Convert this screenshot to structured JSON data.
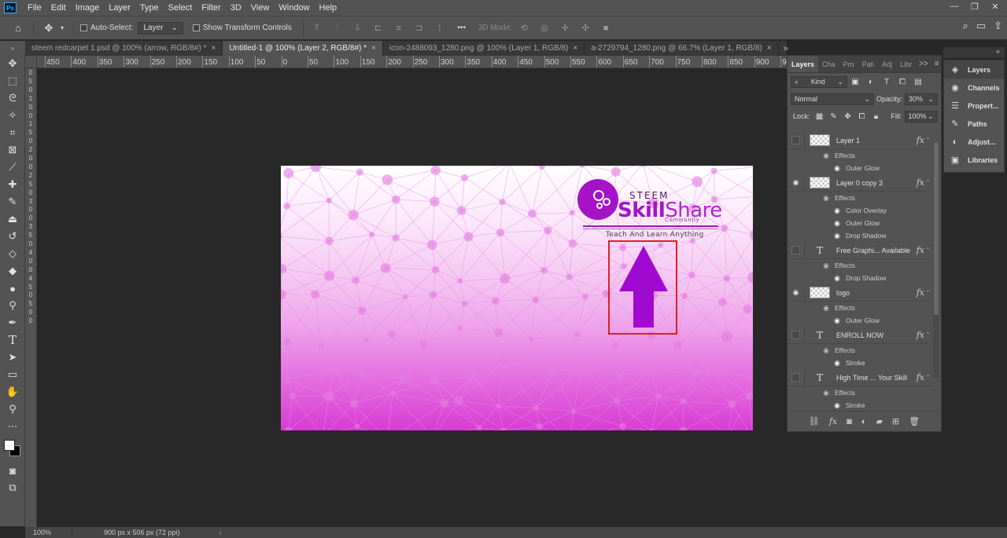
{
  "menu": [
    "File",
    "Edit",
    "Image",
    "Layer",
    "Type",
    "Select",
    "Filter",
    "3D",
    "View",
    "Window",
    "Help"
  ],
  "app_logo": "Ps",
  "options": {
    "auto_select_label": "Auto-Select:",
    "auto_select_value": "Layer",
    "show_transform_label": "Show Transform Controls",
    "mode_3d_label": "3D Mode:",
    "more": "•••"
  },
  "tabs": [
    {
      "label": "steem redcarpet 1.psd @ 100% (arrow, RGB/8#) *",
      "close": "×"
    },
    {
      "label": "Untitled-1 @ 100% (Layer 2, RGB/8#) *",
      "close": "×"
    },
    {
      "label": "icon-2488093_1280.png @ 100% (Layer 1, RGB/8)",
      "close": "×"
    },
    {
      "label": "a-2729794_1280.png @ 66.7% (Layer 1, RGB/8)",
      "close": "×"
    }
  ],
  "tabs_more": "»",
  "ruler_top": [
    "450",
    "400",
    "350",
    "300",
    "250",
    "200",
    "150",
    "100",
    "50",
    "0",
    "50",
    "100",
    "150",
    "200",
    "250",
    "300",
    "350",
    "400",
    "450",
    "500",
    "550",
    "600",
    "650",
    "700",
    "750",
    "800",
    "850",
    "900",
    "950"
  ],
  "ruler_left": [
    "0",
    "5",
    "0",
    "1",
    "0",
    "0",
    "1",
    "5",
    "0",
    "2",
    "0",
    "0",
    "2",
    "5",
    "0",
    "3",
    "0",
    "0",
    "3",
    "5",
    "0",
    "4",
    "0",
    "0",
    "4",
    "5",
    "0",
    "5",
    "0",
    "0"
  ],
  "artwork": {
    "brand_steem": "STEEM",
    "brand_skill": "Skill",
    "brand_share": "Share",
    "brand_community": "Community",
    "tagline": "Teach And Learn Anything",
    "arrow_color": "#a00ad0",
    "highlight_box_color": "#e0201e"
  },
  "status": {
    "zoom": "100%",
    "doc_info": "900 px x 506 px (72 ppi)",
    "caret": "›"
  },
  "layers_panel": {
    "tabs": [
      "Layers",
      "Cha",
      "Pro",
      "Pati",
      "Adj",
      "Libr"
    ],
    "tabs_more": ">>",
    "kind_label": "Kind",
    "blend_mode": "Normal",
    "opacity_label": "Opacity:",
    "opacity_value": "30%",
    "lock_label": "Lock:",
    "fill_label": "Fill:",
    "fill_value": "100%",
    "effects_label": "Effects",
    "fx": "fx",
    "layers": [
      {
        "name": "Layer 1",
        "type": "image",
        "visible": false,
        "effects": [
          "Outer Glow"
        ]
      },
      {
        "name": "Layer 0 copy 3",
        "type": "image",
        "visible": true,
        "effects": [
          "Color Overlay",
          "Outer Glow",
          "Drop Shadow"
        ]
      },
      {
        "name": "Free Graphi... Available",
        "type": "text",
        "visible": false,
        "effects": [
          "Drop Shadow"
        ]
      },
      {
        "name": "logo",
        "type": "image",
        "visible": true,
        "effects": [
          "Outer Glow"
        ]
      },
      {
        "name": "ENROLL NOW",
        "type": "text",
        "visible": false,
        "effects": [
          "Stroke"
        ]
      },
      {
        "name": "High Time ... Your Skill",
        "type": "text",
        "visible": false,
        "effects": [
          "Stroke"
        ]
      }
    ]
  },
  "right_column": [
    {
      "label": "Layers",
      "icon": "layers-icon",
      "glyph": "◈"
    },
    {
      "label": "Channels",
      "icon": "channels-icon",
      "glyph": "◉"
    },
    {
      "label": "Propert...",
      "icon": "properties-icon",
      "glyph": "☰"
    },
    {
      "label": "Paths",
      "icon": "paths-icon",
      "glyph": "✎"
    },
    {
      "label": "Adjust...",
      "icon": "adjustments-icon",
      "glyph": "◐"
    },
    {
      "label": "Libraries",
      "icon": "libraries-icon",
      "glyph": "▣"
    }
  ]
}
